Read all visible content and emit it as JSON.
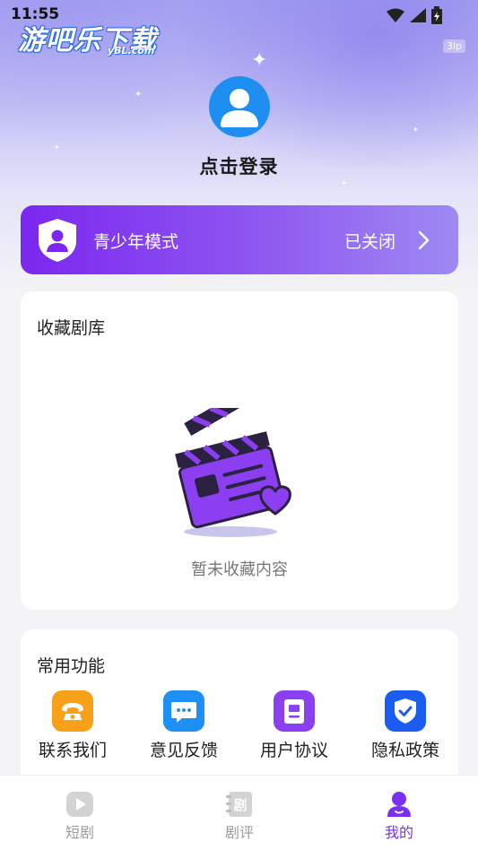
{
  "status_bar": {
    "time": "11:55",
    "watermark": "游吧乐下载",
    "watermark_domain": "yBL.com",
    "tag": "3lp"
  },
  "profile": {
    "login_label": "点击登录",
    "avatar_color": "#1e8ff0"
  },
  "youth_mode": {
    "label": "青少年模式",
    "status": "已关闭"
  },
  "favorites": {
    "title": "收藏剧库",
    "empty_text": "暂未收藏内容"
  },
  "functions": {
    "title": "常用功能",
    "items": [
      {
        "label": "联系我们",
        "icon": "phone-icon",
        "color": "#f7a11b"
      },
      {
        "label": "意见反馈",
        "icon": "chat-icon",
        "color": "#1e90f5"
      },
      {
        "label": "用户协议",
        "icon": "document-icon",
        "color": "#8a3ff0"
      },
      {
        "label": "隐私政策",
        "icon": "shield-check-icon",
        "color": "#1d5cf0"
      }
    ]
  },
  "tabbar": {
    "tabs": [
      {
        "label": "短剧",
        "icon": "play-icon",
        "active": false
      },
      {
        "label": "剧评",
        "icon": "review-icon",
        "active": false
      },
      {
        "label": "我的",
        "icon": "profile-icon",
        "active": true
      }
    ]
  },
  "colors": {
    "accent": "#7b2ff0",
    "youth_gradient_start": "#7b27ef",
    "youth_gradient_end": "#9e8af2"
  }
}
